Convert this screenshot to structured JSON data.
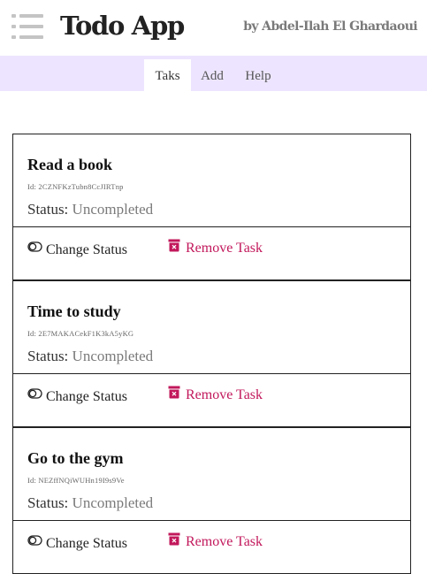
{
  "header": {
    "app_title": "Todo App",
    "byline": "by Abdel-Ilah El Ghardaoui"
  },
  "tabs": [
    {
      "label": "Taks",
      "active": true
    },
    {
      "label": "Add",
      "active": false
    },
    {
      "label": "Help",
      "active": false
    }
  ],
  "tasks": [
    {
      "title": "Read a book",
      "id_label": "Id:",
      "id": "2CZNFKzTubn8CcJIRTnp",
      "status_label": "Status:",
      "status": "Uncompleted",
      "change_label": "Change Status",
      "remove_label": "Remove Task"
    },
    {
      "title": "Time to study",
      "id_label": "Id:",
      "id": "2E7MAKACekF1K3kA5yKG",
      "status_label": "Status:",
      "status": "Uncompleted",
      "change_label": "Change Status",
      "remove_label": "Remove Task"
    },
    {
      "title": "Go to the gym",
      "id_label": "Id:",
      "id": "NEZffNQiWUHn19I9s9Ve",
      "status_label": "Status:",
      "status": "Uncompleted",
      "change_label": "Change Status",
      "remove_label": "Remove Task"
    }
  ],
  "colors": {
    "tabbar_bg": "#ede5ff",
    "remove_accent": "#c2185b",
    "status_value": "#7a7a7a"
  },
  "icons": {
    "menu": "hamburger-menu-icon",
    "toggle": "toggle-off-icon",
    "remove": "trash-icon"
  }
}
